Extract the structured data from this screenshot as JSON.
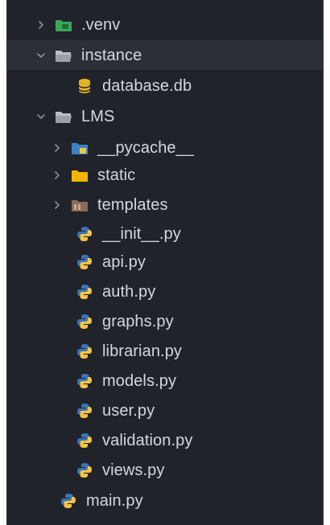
{
  "explorer": {
    "items": [
      {
        "label": ".venv",
        "kind": "folder",
        "icon": "venv-folder-icon",
        "expanded": false
      },
      {
        "label": "instance",
        "kind": "folder",
        "icon": "folder-open-icon",
        "expanded": true
      },
      {
        "label": "database.db",
        "kind": "file",
        "icon": "database-icon"
      },
      {
        "label": "LMS",
        "kind": "folder",
        "icon": "folder-open-icon",
        "expanded": true
      },
      {
        "label": "__pycache__",
        "kind": "folder",
        "icon": "pycache-folder-icon",
        "expanded": false
      },
      {
        "label": "static",
        "kind": "folder",
        "icon": "static-folder-icon",
        "expanded": false
      },
      {
        "label": "templates",
        "kind": "folder",
        "icon": "templates-folder-icon",
        "expanded": false
      },
      {
        "label": "__init__.py",
        "kind": "file",
        "icon": "python-icon"
      },
      {
        "label": "api.py",
        "kind": "file",
        "icon": "python-icon"
      },
      {
        "label": "auth.py",
        "kind": "file",
        "icon": "python-icon"
      },
      {
        "label": "graphs.py",
        "kind": "file",
        "icon": "python-icon"
      },
      {
        "label": "librarian.py",
        "kind": "file",
        "icon": "python-icon"
      },
      {
        "label": "models.py",
        "kind": "file",
        "icon": "python-icon"
      },
      {
        "label": "user.py",
        "kind": "file",
        "icon": "python-icon"
      },
      {
        "label": "validation.py",
        "kind": "file",
        "icon": "python-icon"
      },
      {
        "label": "views.py",
        "kind": "file",
        "icon": "python-icon"
      },
      {
        "label": "main.py",
        "kind": "file",
        "icon": "python-icon"
      }
    ]
  },
  "colors": {
    "background": "#20232a",
    "selected_row": "#2b2f37",
    "text": "#d4d8de",
    "chevron": "#8a8f99",
    "venv_green": "#3aa65a",
    "folder_gray": "#b9bec8",
    "pycache_blue": "#3b82c4",
    "static_yellow": "#f2b400",
    "templates_brown": "#8b6b5a",
    "python_blue": "#3b74b8",
    "python_yellow": "#f4c542",
    "database_yellow": "#e6b422"
  }
}
